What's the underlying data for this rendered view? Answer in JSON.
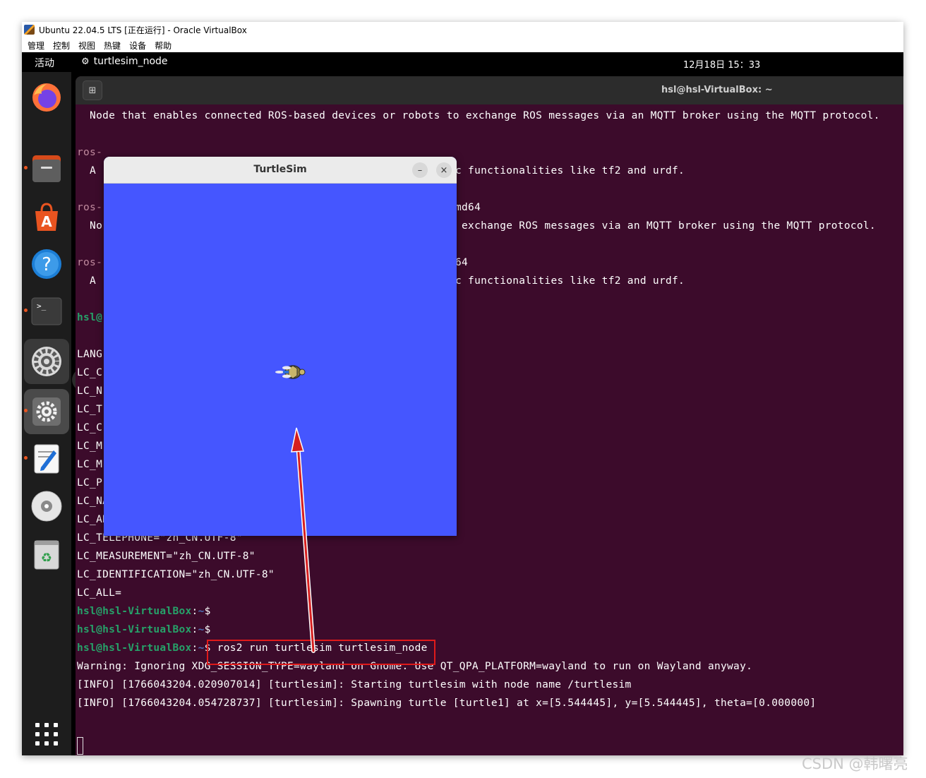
{
  "virtualbox": {
    "title": "Ubuntu 22.04.5 LTS [正在运行] - Oracle VirtualBox",
    "menu": [
      "管理",
      "控制",
      "视图",
      "热键",
      "设备",
      "帮助"
    ]
  },
  "topbar": {
    "activities": "活动",
    "app_name": "turtlesim_node",
    "clock": "12月18日  15：33"
  },
  "dock": {
    "tooltip": "设置",
    "items": [
      "firefox-icon",
      "files-icon",
      "app-center-icon",
      "help-icon",
      "terminal-icon",
      "settings-alt-icon",
      "settings-icon",
      "text-editor-icon",
      "disc-icon",
      "trash-icon",
      "show-apps-icon"
    ]
  },
  "terminal": {
    "title": "hsl@hsl-VirtualBox: ~",
    "prompt_user": "hsl@hsl-VirtualBox",
    "prompt_path": "~",
    "lines": {
      "l01": "  Node that enables connected ROS-based devices or robots to exchange ROS messages via an MQTT broker using the MQTT protocol.",
      "l02": "ros-",
      "l03": "  A ",
      "l03r": "c functionalities like tf2 and urdf.",
      "l04": "ros-",
      "l04r": "md64",
      "l05": "  No",
      "l05r": " exchange ROS messages via an MQTT broker using the MQTT protocol.",
      "l06": "ros-",
      "l06r": "64",
      "l07": "  A ",
      "l07r": "c functionalities like tf2 and urdf.",
      "l08": "hsl@",
      "l09": "LANG",
      "l10": "LC_C",
      "l11": "LC_N",
      "l12": "LC_T",
      "l13": "LC_C",
      "l14": "LC_M",
      "l15": "LC_M",
      "l16": "LC_P",
      "l17": "LC_NAME=\"zh_CN.UTF-8\"",
      "l18": "LC_ADDRESS=\"zh_CN.UTF-8\"",
      "l19": "LC_TELEPHONE=\"zh_CN.UTF-8\"",
      "l20": "LC_MEASUREMENT=\"zh_CN.UTF-8\"",
      "l21": "LC_IDENTIFICATION=\"zh_CN.UTF-8\"",
      "l22": "LC_ALL=",
      "cmd": " ros2 run turtlesim turtlesim_node",
      "warn": "Warning: Ignoring XDG_SESSION_TYPE=wayland on Gnome. Use QT_QPA_PLATFORM=wayland to run on Wayland anyway.",
      "info1": "[INFO] [1766043204.020907014] [turtlesim]: Starting turtlesim with node name /turtlesim",
      "info2": "[INFO] [1766043204.054728737] [turtlesim]: Spawning turtle [turtle1] at x=[5.544445], y=[5.544445], theta=[0.000000]"
    }
  },
  "turtlesim": {
    "title": "TurtleSim",
    "minimize": "–",
    "close": "×",
    "background": "#4556ff"
  },
  "watermark": "CSDN @韩曙亮"
}
